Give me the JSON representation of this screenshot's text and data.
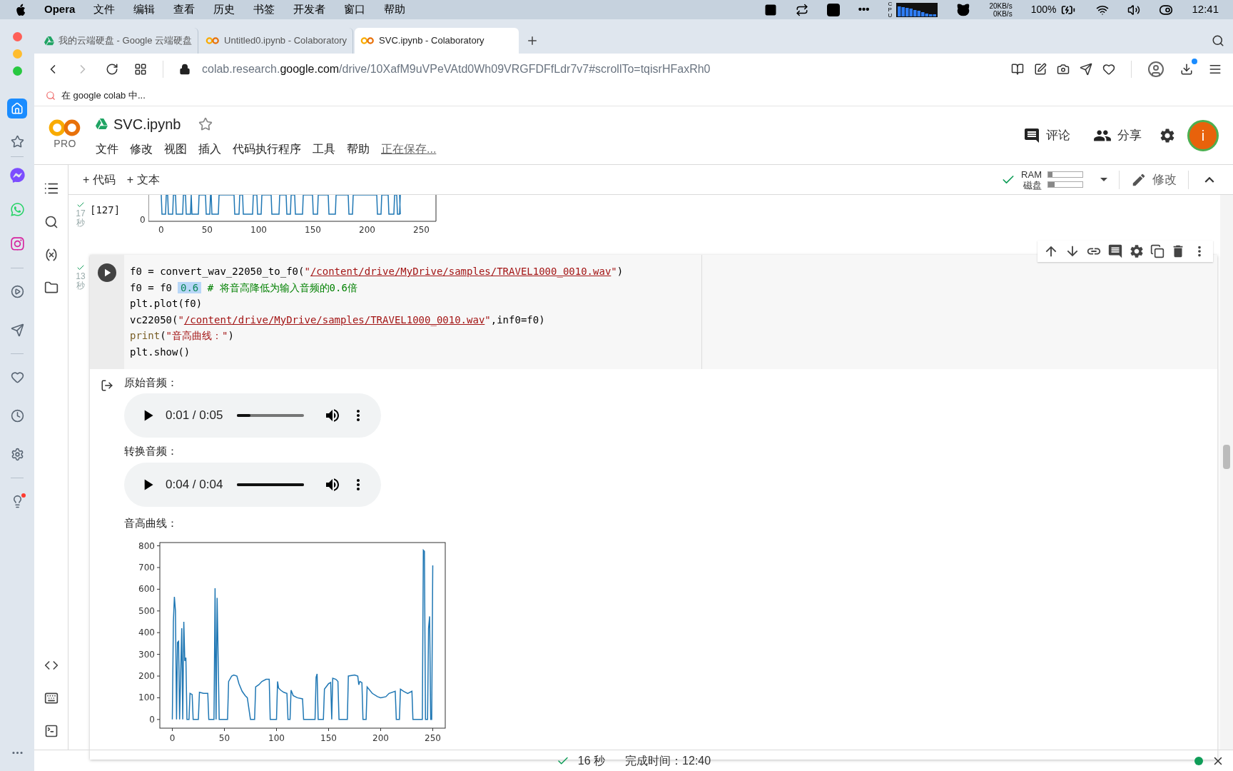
{
  "menubar": {
    "app": "Opera",
    "items": [
      "文件",
      "编辑",
      "查看",
      "历史",
      "书签",
      "开发者",
      "窗口",
      "帮助"
    ],
    "more": "•••",
    "cpu_label": "CPU",
    "net_up": "20KB/s",
    "net_down": "0KB/s",
    "battery": "100%",
    "clock": "12:41"
  },
  "tabs": [
    {
      "title": "我的云端硬盘 - Google 云端硬盘",
      "selected": false
    },
    {
      "title": "Untitled0.ipynb - Colaboratory",
      "selected": false
    },
    {
      "title": "SVC.ipynb - Colaboratory",
      "selected": true
    }
  ],
  "address": {
    "prefix": "colab.research.",
    "domain": "google.com",
    "path": "/drive/10XafM9uVPeVAtd0Wh09VRGFDFfLdr7v7#scrollTo=tqisrHFaxRh0"
  },
  "bookmark": "在 google colab 中...",
  "colab": {
    "plan": "PRO",
    "notebook": "SVC.ipynb",
    "menu": [
      "文件",
      "修改",
      "视图",
      "插入",
      "代码执行程序",
      "工具",
      "帮助"
    ],
    "saving": "正在保存...",
    "comment": "评论",
    "share": "分享",
    "avatar": "i",
    "toolbar": {
      "add_code": "+ 代码",
      "add_text": "+ 文本",
      "ram_label": "RAM",
      "disk_label": "磁盘",
      "ram": {
        "level": 0.12
      },
      "disk": {
        "level": 0.18
      },
      "edit": "修改"
    }
  },
  "prev_cell": {
    "count": "[127]",
    "seconds": "17",
    "unit": "秒",
    "xticks": [
      "0",
      "50",
      "100",
      "150",
      "200",
      "250"
    ],
    "ytick": "0"
  },
  "cell": {
    "seconds": "13",
    "unit": "秒",
    "lines": [
      [
        {
          "kind": "plain",
          "text": "f0 = convert_wav_22050_to_f0("
        },
        {
          "kind": "string",
          "text": "\""
        },
        {
          "kind": "path",
          "text": "/content/drive/MyDrive/samples/TRAVEL1000_0010.wav"
        },
        {
          "kind": "string",
          "text": "\""
        },
        {
          "kind": "plain",
          "text": ")"
        }
      ],
      [
        {
          "kind": "plain",
          "text": "f0 = f0"
        },
        {
          "kind": "selected",
          "text": "0.6"
        },
        {
          "kind": "comment",
          "text": " # 将音高降低为输入音频的0.6倍"
        }
      ],
      [
        {
          "kind": "plain",
          "text": "plt.plot(f0)"
        }
      ],
      [
        {
          "kind": "plain",
          "text": "vc22050("
        },
        {
          "kind": "string",
          "text": "\""
        },
        {
          "kind": "path",
          "text": "/content/drive/MyDrive/samples/TRAVEL1000_0010.wav"
        },
        {
          "kind": "string",
          "text": "\""
        },
        {
          "kind": "plain",
          "text": ",inf0=f0)"
        }
      ],
      [
        {
          "kind": "builtin",
          "text": "print"
        },
        {
          "kind": "plain",
          "text": "("
        },
        {
          "kind": "string",
          "text": "\"音高曲线：\""
        },
        {
          "kind": "plain",
          "text": ")"
        }
      ],
      [
        {
          "kind": "plain",
          "text": "plt.show()"
        }
      ]
    ]
  },
  "output": {
    "players": [
      {
        "label": "原始音频：",
        "time": "0:01 / 0:05",
        "level": 0.2
      },
      {
        "label": "转换音频：",
        "time": "0:04 / 0:04",
        "level": 1
      }
    ],
    "chart_label": "音高曲线：",
    "chart_data": {
      "type": "line",
      "xlim": [
        -12,
        262
      ],
      "ylim": [
        -40,
        815
      ],
      "xticks": [
        0,
        50,
        100,
        150,
        200,
        250
      ],
      "yticks": [
        0,
        100,
        200,
        300,
        400,
        500,
        600,
        700,
        800
      ],
      "x": [
        0,
        1,
        2,
        3,
        4,
        5,
        6,
        7,
        9,
        10,
        11,
        12,
        13,
        14,
        16,
        17,
        19,
        20,
        25,
        26,
        30,
        34,
        35,
        40,
        41,
        42,
        43,
        45,
        53,
        54,
        57,
        59,
        62,
        64,
        67,
        70,
        72,
        75,
        79,
        80,
        83,
        86,
        90,
        93,
        94,
        100,
        101,
        102,
        104,
        107,
        110,
        111,
        113,
        114,
        116,
        120,
        125,
        126,
        137,
        138,
        139,
        140,
        145,
        146,
        150,
        152,
        153,
        154,
        157,
        159,
        160,
        168,
        169,
        175,
        178,
        179,
        180,
        182,
        183,
        186,
        187,
        192,
        197,
        200,
        205,
        208,
        214,
        215,
        218,
        219,
        222,
        226,
        230,
        231,
        240,
        241,
        242,
        243,
        245,
        246,
        247,
        248,
        249,
        250
      ],
      "series": [
        {
          "color": "#1f77b4",
          "values": [
            0,
            450,
            565,
            500,
            0,
            355,
            360,
            0,
            420,
            0,
            450,
            270,
            285,
            0,
            0,
            120,
            115,
            0,
            0,
            125,
            120,
            120,
            0,
            0,
            605,
            0,
            560,
            0,
            0,
            175,
            200,
            205,
            200,
            165,
            130,
            110,
            100,
            0,
            0,
            150,
            160,
            175,
            185,
            185,
            0,
            0,
            175,
            145,
            135,
            125,
            120,
            0,
            0,
            135,
            110,
            100,
            95,
            0,
            0,
            195,
            210,
            0,
            0,
            140,
            165,
            170,
            0,
            190,
            185,
            175,
            0,
            0,
            200,
            205,
            200,
            160,
            175,
            170,
            0,
            0,
            150,
            120,
            105,
            100,
            105,
            120,
            130,
            0,
            0,
            140,
            130,
            120,
            130,
            0,
            0,
            780,
            775,
            0,
            0,
            420,
            475,
            0,
            0,
            710
          ]
        }
      ]
    }
  },
  "status": {
    "duration": "16 秒",
    "finished": "完成时间：12:40"
  }
}
